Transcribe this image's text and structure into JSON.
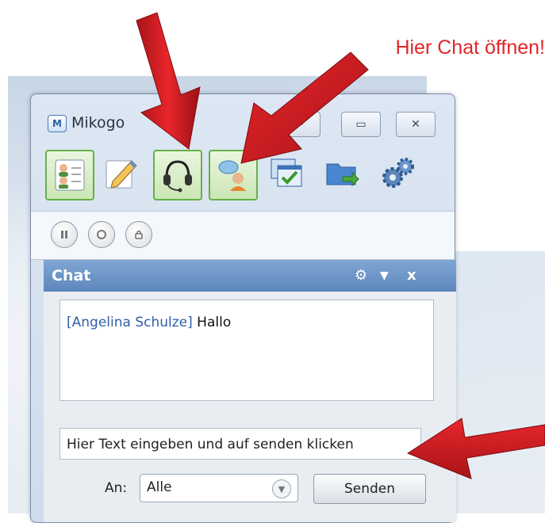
{
  "annotation": {
    "caption": "Hier Chat öffnen!"
  },
  "window": {
    "title": "Mikogo",
    "app_icon_letter": "M",
    "buttons": {
      "minimize": "–",
      "maximize": "▭",
      "close": "✕"
    }
  },
  "toolbar": {
    "items": [
      {
        "name": "participants-tool",
        "icon": "participants-icon",
        "active": true
      },
      {
        "name": "whiteboard-tool",
        "icon": "pencil-icon",
        "active": false
      },
      {
        "name": "audio-tool",
        "icon": "headset-icon",
        "active": true
      },
      {
        "name": "chat-tool",
        "icon": "chat-icon",
        "active": true
      },
      {
        "name": "screen-share-tool",
        "icon": "window-check-icon",
        "active": false
      },
      {
        "name": "file-transfer-tool",
        "icon": "folder-arrow-icon",
        "active": false
      },
      {
        "name": "settings-tool",
        "icon": "gears-icon",
        "active": false
      }
    ]
  },
  "media_controls": {
    "pause": "pause-icon",
    "record": "record-icon",
    "stop": "lock-icon"
  },
  "chat": {
    "header_title": "Chat",
    "messages": [
      {
        "sender": "[Angelina Schulze]",
        "text": "Hallo"
      }
    ],
    "input_value": "Hier Text eingeben und auf senden klicken",
    "to_label": "An:",
    "to_selected": "Alle",
    "send_label": "Senden"
  },
  "colors": {
    "accent_red": "#e0262b",
    "header_blue": "#6b93c7",
    "active_green": "#66b046"
  }
}
